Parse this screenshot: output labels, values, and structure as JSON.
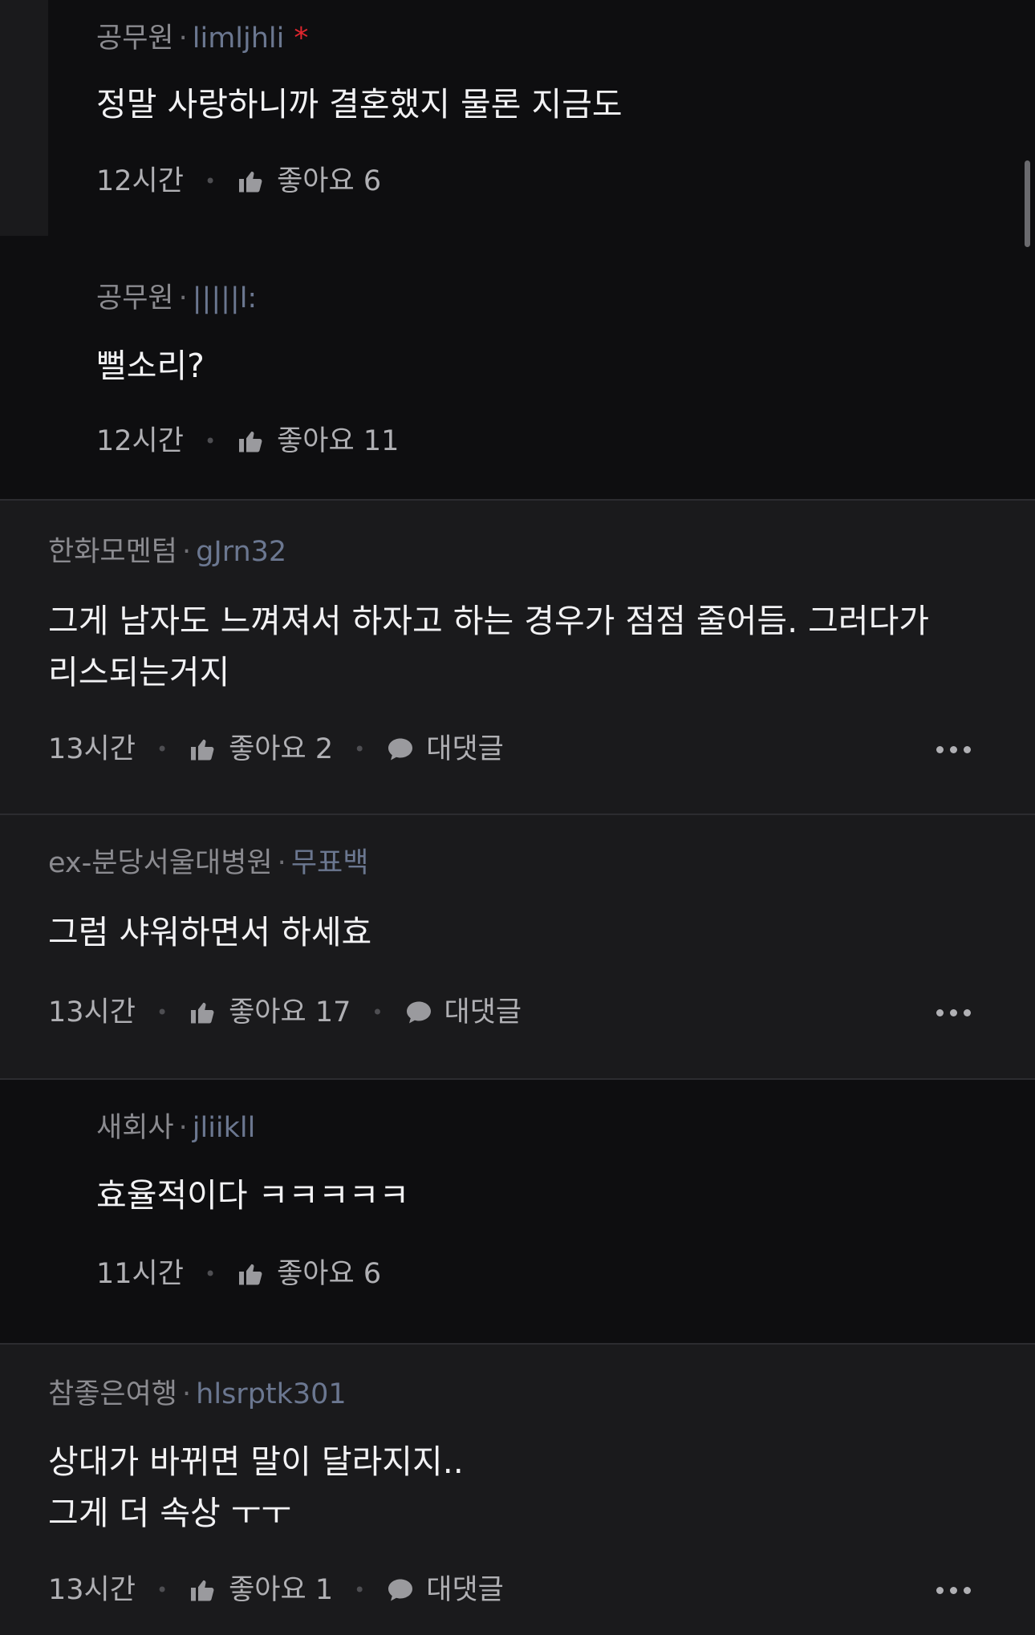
{
  "comments": [
    {
      "company": "공무원",
      "nick": "limljhli",
      "star": "*",
      "text": "정말 사랑하니까 결혼했지 물론 지금도",
      "time": "12시간",
      "like": "좋아요 6"
    },
    {
      "company": "공무원",
      "nick": "|||||l:",
      "text": "뻘소리?",
      "time": "12시간",
      "like": "좋아요 11"
    },
    {
      "company": "한화모멘텀",
      "nick": "gJrn32",
      "text": "그게 남자도 느껴져서 하자고 하는 경우가 점점 줄어듬. 그러다가\n리스되는거지",
      "time": "13시간",
      "like": "좋아요 2",
      "reply": "대댓글"
    },
    {
      "company": "ex-분당서울대병원",
      "nick": "무표백",
      "text": "그럼 샤워하면서 하세효",
      "time": "13시간",
      "like": "좋아요 17",
      "reply": "대댓글"
    },
    {
      "company": "새회사",
      "nick": "jliikll",
      "text": "효율적이다 ㅋㅋㅋㅋㅋ",
      "time": "11시간",
      "like": "좋아요 6"
    },
    {
      "company": "참좋은여행",
      "nick": "hlsrptk301",
      "text": "상대가 바뀌면 말이 달라지지..\n그게 더 속상 ㅜㅜ",
      "time": "13시간",
      "like": "좋아요 1",
      "reply": "대댓글"
    }
  ],
  "icons": {
    "like": "thumbs-up-icon",
    "reply": "speech-bubble-icon",
    "more": "more-dots-icon"
  },
  "colors": {
    "background": "#1a1a1c",
    "reply_background": "#0e0e10",
    "nickname": "#6b7790",
    "star": "#e0262e"
  }
}
